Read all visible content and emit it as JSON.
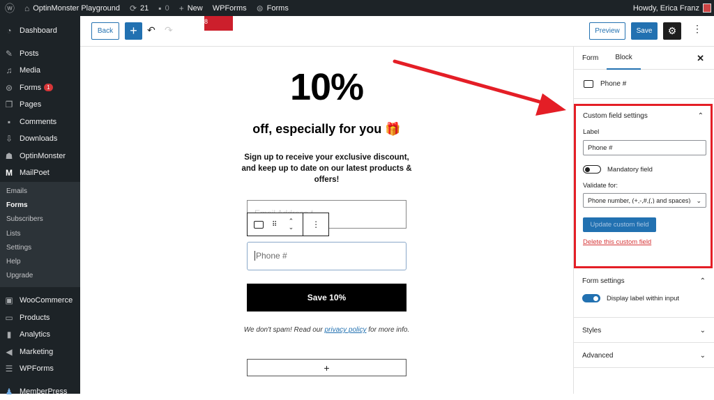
{
  "admin_bar": {
    "wp_logo": "wordpress-icon",
    "site_name": "OptinMonster Playground",
    "updates_count": "21",
    "comments_count": "0",
    "new_label": "New",
    "wpforms_label": "WPForms",
    "forms_label": "Forms",
    "greeting": "Howdy, Erica Franz"
  },
  "sidebar": {
    "items": [
      {
        "label": "Dashboard",
        "icon": "dashboard-icon"
      },
      {
        "label": "Posts",
        "icon": "pin-icon"
      },
      {
        "label": "Media",
        "icon": "media-icon"
      },
      {
        "label": "Forms",
        "icon": "forms-icon",
        "badge": "1"
      },
      {
        "label": "Pages",
        "icon": "pages-icon"
      },
      {
        "label": "Comments",
        "icon": "comment-icon"
      },
      {
        "label": "Downloads",
        "icon": "download-icon"
      },
      {
        "label": "OptinMonster",
        "icon": "optinmonster-icon"
      },
      {
        "label": "MailPoet",
        "icon": "mailpoet-icon"
      }
    ],
    "submenu": [
      "Emails",
      "Forms",
      "Subscribers",
      "Lists",
      "Settings",
      "Help",
      "Upgrade"
    ],
    "submenu_current": "Forms",
    "items_after": [
      {
        "label": "WooCommerce",
        "icon": "woocommerce-icon"
      },
      {
        "label": "Products",
        "icon": "archive-icon"
      },
      {
        "label": "Analytics",
        "icon": "bar-chart-icon"
      },
      {
        "label": "Marketing",
        "icon": "megaphone-icon"
      },
      {
        "label": "WPForms",
        "icon": "wpforms-icon"
      },
      {
        "label": "MemberPress",
        "icon": "members-icon"
      }
    ]
  },
  "toolbar": {
    "back_label": "Back",
    "add_label": "+",
    "red_tag_text": "8",
    "preview_label": "Preview",
    "save_label": "Save"
  },
  "form": {
    "headline": "10%",
    "subhead": "off, especially for you",
    "subhead_emoji": "🎁",
    "description": "Sign up to receive your exclusive discount, and keep up to date on our latest products & offers!",
    "email_placeholder": "Email Address *",
    "phone_placeholder": "Phone #",
    "submit_label": "Save 10%",
    "note_before": "We don't spam! Read our ",
    "note_link": "privacy policy",
    "note_after": " for more info.",
    "add_block": "+"
  },
  "panel": {
    "tabs": [
      "Form",
      "Block"
    ],
    "active_tab": "Block",
    "block_name": "Phone #",
    "custom_field": {
      "title": "Custom field settings",
      "label_caption": "Label",
      "label_value": "Phone #",
      "mandatory_label": "Mandatory field",
      "mandatory_on": false,
      "validate_caption": "Validate for:",
      "validate_value": "Phone number, (+,-,#,(,) and spaces)",
      "update_label": "Update custom field",
      "delete_label": "Delete this custom field"
    },
    "form_settings": {
      "title": "Form settings",
      "display_label_toggle": "Display label within input",
      "display_label_on": true
    },
    "styles_title": "Styles",
    "advanced_title": "Advanced"
  },
  "annotation": {
    "color": "#e41e26"
  }
}
